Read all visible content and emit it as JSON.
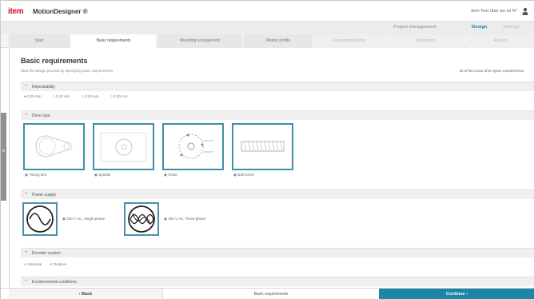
{
  "app": {
    "logo": "item",
    "title": "MotionDesigner ®",
    "user_name": "item Test über wo ist N°"
  },
  "main_nav": [
    {
      "label": "Project management"
    },
    {
      "label": "Design"
    },
    {
      "label": "Settings"
    }
  ],
  "steps": [
    {
      "label": "Start"
    },
    {
      "label": "Basic requirements"
    },
    {
      "label": "Mounting arrangement"
    },
    {
      "label": "Motion profile"
    },
    {
      "label": "Recommendations"
    },
    {
      "label": "Application"
    },
    {
      "label": "Results"
    }
  ],
  "page": {
    "title": "Basic requirements",
    "description": "Start the design process by specifying basic requirements",
    "count_text": "18 of 98 Linear drive types requirements"
  },
  "sections": {
    "repeatability": {
      "label": "Repeatability",
      "options": [
        "0.05 mm",
        "0.10 mm",
        "0.15 mm",
        "0.20 mm"
      ]
    },
    "drive_type": {
      "label": "Drive type",
      "options": [
        "Timing belt",
        "Spindle",
        "Chain",
        "Ball screw"
      ]
    },
    "power_supply": {
      "label": "Power supply",
      "options": [
        "230 V AC, Single-phase",
        "400 V AC, Three-phase"
      ]
    },
    "encoder_system": {
      "label": "Encoder system",
      "options": [
        "Absolute",
        "Relative"
      ]
    },
    "environmental": {
      "label": "Environmental conditions"
    }
  },
  "footer": {
    "back_label": "‹  Back",
    "center_label": "Basic requirements",
    "continue_label": "Continue  ›"
  },
  "colors": {
    "brand_red": "#d1102a",
    "accent_blue": "#1c86a8",
    "card_border": "#3f8fa6"
  }
}
